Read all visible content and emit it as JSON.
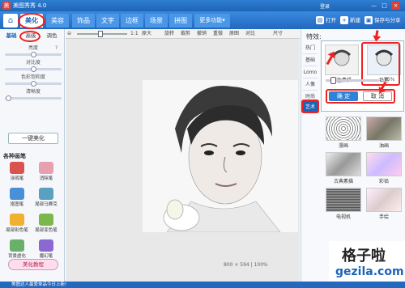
{
  "title_bar": {
    "app_title": "美图秀秀 4.0",
    "login": "登录",
    "min": "—",
    "max": "□",
    "close": "×"
  },
  "toolbar": {
    "home": "⌂",
    "tabs": [
      "美化",
      "美容",
      "饰品",
      "文字",
      "边框",
      "场景",
      "拼图",
      "更多功能▾"
    ],
    "open": "打开",
    "new": "新建",
    "save_share": "保存与分享"
  },
  "left_panel": {
    "subtabs": [
      "基础",
      "高级",
      "调色"
    ],
    "sliders": [
      {
        "label": "亮度",
        "value": 0.5
      },
      {
        "label": "对比度",
        "value": 0.5
      },
      {
        "label": "色彩饱和度",
        "value": 0.5
      },
      {
        "label": "清晰度",
        "value": 0.05
      }
    ],
    "onekey": "一键美化",
    "brush_header": "各种画笔",
    "brushes": [
      {
        "label": "涂鸦笔",
        "color": "#d9534f"
      },
      {
        "label": "消除笔",
        "color": "#e7a0b0"
      },
      {
        "label": "抠图笔",
        "color": "#4a90d9"
      },
      {
        "label": "局部马赛克",
        "color": "#5aa0c0"
      },
      {
        "label": "局部彩色笔",
        "color": "#f0b030"
      },
      {
        "label": "局部变色笔",
        "color": "#7ab84a"
      },
      {
        "label": "背景虚化",
        "color": "#6ab06a"
      },
      {
        "label": "魔幻笔",
        "color": "#8a6ad0"
      }
    ],
    "course": "美化教程"
  },
  "canvas": {
    "tools": [
      "1:1",
      "原大",
      "旋转",
      "裁剪",
      "撤销",
      "重做",
      "原图",
      "对比",
      "尺寸"
    ],
    "zoom_readout": "800 × 594 | 100%"
  },
  "right_panel": {
    "title": "特效:",
    "categories": [
      "热门",
      "基础",
      "Lomo",
      "人像",
      "时尚",
      "艺术"
    ],
    "active_category": "艺术",
    "card_items": [
      "写生素描",
      "铅笔"
    ],
    "pct": "75%",
    "ok": "确 定",
    "cancel": "取 消",
    "effects": [
      "漫画",
      "油画",
      "古典素描",
      "彩铅",
      "电视机",
      "手绘"
    ]
  },
  "status": "美图达人最爱单品今日上新!",
  "watermark": {
    "line1": "格子啦",
    "line2": "gezila.com"
  }
}
